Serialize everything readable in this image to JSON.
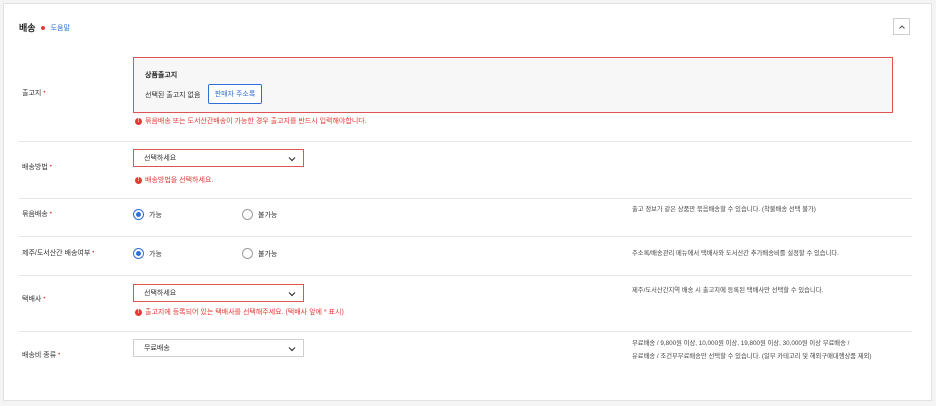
{
  "header": {
    "title": "배송",
    "help_label": "도움말"
  },
  "rows": {
    "warehouse": {
      "label": "출고지",
      "box_title": "상품출고지",
      "selected_text": "선택된 출고지 없음",
      "address_button": "판매자 주소록",
      "error": "묶음배송 또는 도서산간배송이 가능한 경우 출고지를 반드시 입력해야합니다."
    },
    "method": {
      "label": "배송방법",
      "select_value": "선택하세요",
      "error": "배송방법을 선택하세요."
    },
    "bundle": {
      "label": "묶음배송",
      "option_yes": "가능",
      "option_no": "불가능",
      "selected": "yes",
      "description": "출고 정보가 같은 상품만 묶음배송할 수 있습니다. (착불배송 선택 불가)"
    },
    "island": {
      "label": "제주/도서산간 배송여부",
      "option_yes": "가능",
      "option_no": "불가능",
      "selected": "yes",
      "description": "주소록/배송관리 메뉴에서 택배사와 도서산간 추가배송비를 설정할 수 있습니다."
    },
    "courier": {
      "label": "택배사",
      "select_value": "선택하세요",
      "error": "출고지에 등록되어 있는 택배사를 선택해주세요. (택배사 앞에 * 표시)",
      "description": "제주/도서산간지역 배송 시 출고지에 등록된 택배사만 선택할 수 있습니다."
    },
    "fee_type": {
      "label": "배송비 종류",
      "select_value": "무료배송",
      "description_line1": "무료배송 / 9,800원 이상, 10,000원 이상, 19,800원 이상, 30,000원 이상 무료배송 /",
      "description_line2": "유료배송 / 조건부무료배송만 선택할 수 있습니다. (일부 카테고리 및 해외구매대행상품 제외)"
    }
  },
  "colors": {
    "accent": "#2f6fd6",
    "error": "#e53935"
  }
}
